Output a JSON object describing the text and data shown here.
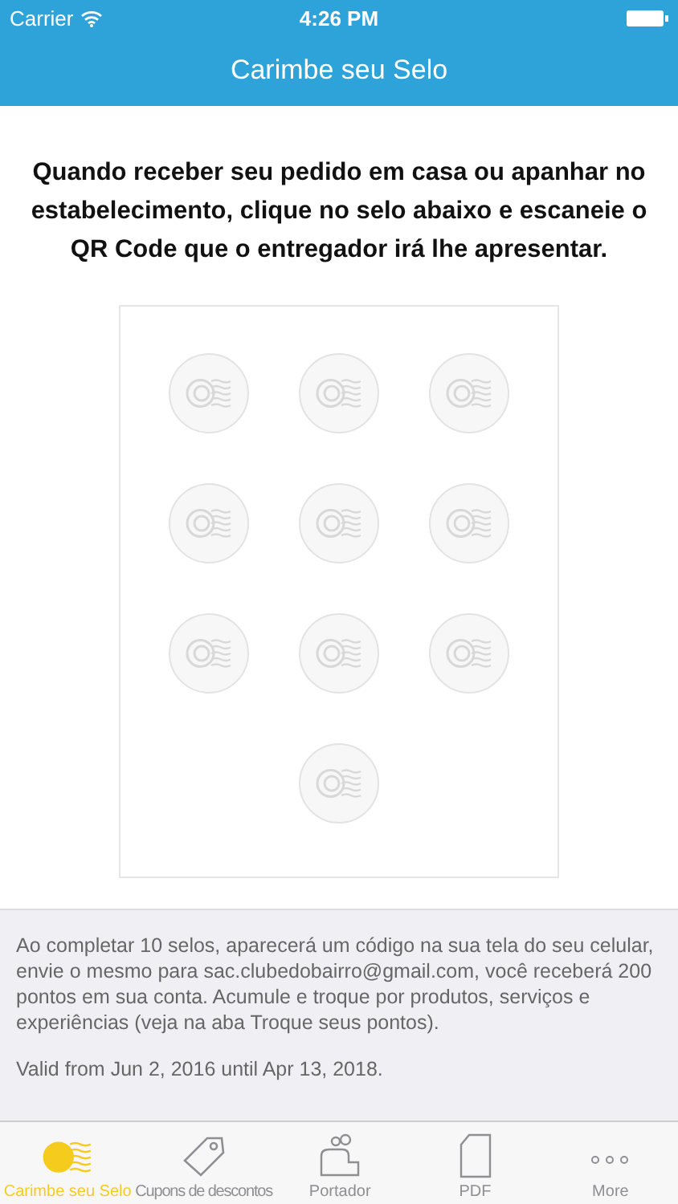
{
  "status_bar": {
    "carrier": "Carrier",
    "time": "4:26 PM"
  },
  "nav": {
    "title": "Carimbe seu Selo"
  },
  "instructions": "Quando receber seu pedido em casa ou apanhar no estabelecimento, clique no selo abaixo e escaneie o QR Code que o entregador irá lhe apresentar.",
  "stamps": [
    {
      "stamped": false
    },
    {
      "stamped": false
    },
    {
      "stamped": false
    },
    {
      "stamped": false
    },
    {
      "stamped": false
    },
    {
      "stamped": false
    },
    {
      "stamped": false
    },
    {
      "stamped": false
    },
    {
      "stamped": false
    },
    {
      "stamped": false
    }
  ],
  "info": {
    "text": "Ao completar 10 selos, aparecerá um código na sua tela do seu celular, envie o mesmo para sac.clubedobairro@gmail.com, você receberá 200 pontos em sua conta.  Acumule e troque por produtos, serviços e experiências (veja na aba Troque seus pontos).",
    "validity": "Valid from Jun 2, 2016 until Apr 13, 2018."
  },
  "tabs": [
    {
      "kind": "stamp",
      "label": "Carimbe seu Selo",
      "selected": true
    },
    {
      "kind": "tag",
      "label": "Cupons de descontos",
      "selected": false
    },
    {
      "kind": "people",
      "label": "Portador",
      "selected": false
    },
    {
      "kind": "document",
      "label": "PDF",
      "selected": false
    },
    {
      "kind": "more",
      "label": "More",
      "selected": false
    }
  ]
}
